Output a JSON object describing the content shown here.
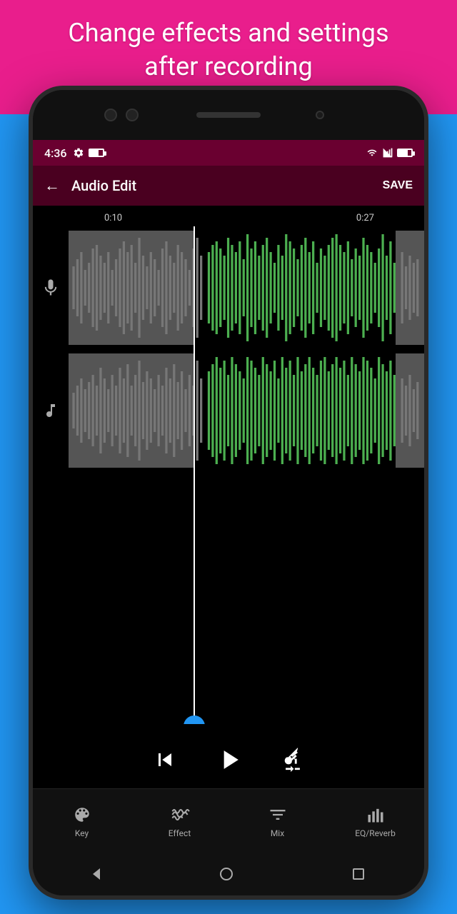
{
  "header": {
    "title": "Change effects and settings\nafter recording"
  },
  "statusBar": {
    "time": "4:36",
    "icons": [
      "gear",
      "battery"
    ],
    "rightIcons": [
      "wifi",
      "signal",
      "battery"
    ]
  },
  "appBar": {
    "title": "Audio Edit",
    "backLabel": "←",
    "saveLabel": "SAVE"
  },
  "timeline": {
    "marker1": "0:10",
    "marker2": "0:27"
  },
  "tracks": [
    {
      "id": "voice",
      "icon": "🎤",
      "type": "microphone"
    },
    {
      "id": "music",
      "icon": "♪",
      "type": "music"
    }
  ],
  "controls": {
    "skipBack": "|◀",
    "play": "▶",
    "trim": "⊡"
  },
  "bottomNav": [
    {
      "id": "key",
      "label": "Key",
      "icon": "𝄞"
    },
    {
      "id": "effect",
      "label": "Effect",
      "icon": "~"
    },
    {
      "id": "mix",
      "label": "Mix",
      "icon": "≡"
    },
    {
      "id": "eqreverb",
      "label": "EQ/Reverb",
      "icon": "▌"
    }
  ],
  "colors": {
    "accent": "#2196f3",
    "waveform": "#4caf50",
    "background": "#000000",
    "appBar": "#4a0020",
    "statusBar": "#6a0030",
    "highlight": "#e91e8c"
  }
}
